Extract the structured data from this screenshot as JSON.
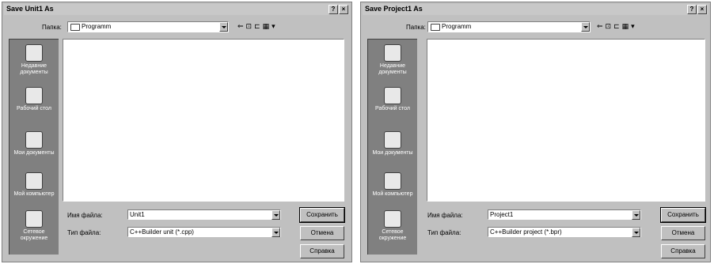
{
  "dialogs": [
    {
      "title": "Save Unit1 As",
      "folder_label": "Папка:",
      "folder_value": "Programm",
      "places": [
        "Недавние документы",
        "Рабочий стол",
        "Мои документы",
        "Мой компьютер",
        "Сетевое окружение"
      ],
      "filename_label": "Имя файла:",
      "filename_value": "Unit1",
      "filetype_label": "Тип файла:",
      "filetype_value": "C++Builder unit (*.cpp)",
      "save_label": "Сохранить",
      "cancel_label": "Отмена",
      "help_label": "Справка"
    },
    {
      "title": "Save Project1 As",
      "folder_label": "Папка:",
      "folder_value": "Programm",
      "places": [
        "Недавние документы",
        "Рабочий стол",
        "Мои документы",
        "Мой компьютер",
        "Сетевое окружение"
      ],
      "filename_label": "Имя файла:",
      "filename_value": "Project1",
      "filetype_label": "Тип файла:",
      "filetype_value": "C++Builder project (*.bpr)",
      "save_label": "Сохранить",
      "cancel_label": "Отмена",
      "help_label": "Справка"
    }
  ],
  "titlebar_buttons": [
    "?",
    "×"
  ],
  "toolbar_icons": [
    "back-icon",
    "up-folder-icon",
    "new-folder-icon",
    "view-menu-icon"
  ],
  "colors": {
    "face": "#c0c0c0",
    "places_bar": "#808080",
    "list_bg": "#ffffff"
  }
}
